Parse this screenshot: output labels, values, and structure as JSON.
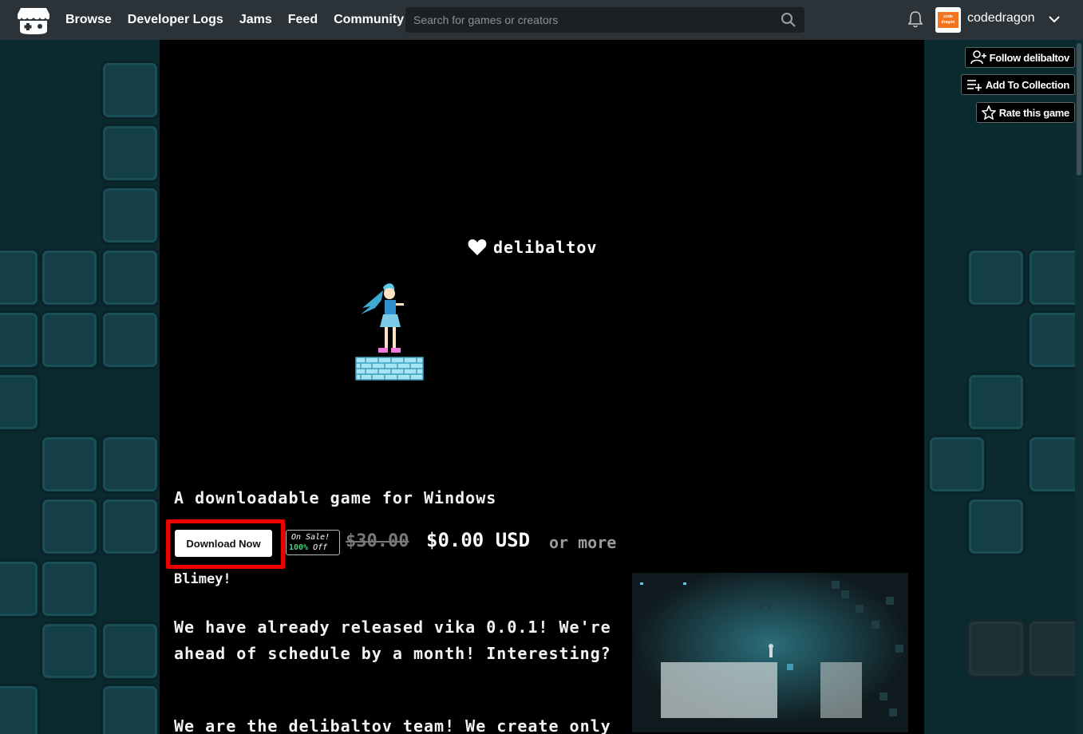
{
  "nav": {
    "items": [
      "Browse",
      "Developer Logs",
      "Jams",
      "Feed",
      "Community"
    ],
    "search_placeholder": "Search for games or creators",
    "username": "codedragon",
    "avatar_text": "code dragon"
  },
  "side_actions": {
    "follow": "Follow delibaltov",
    "collection": "Add To Collection",
    "rate": "Rate this game"
  },
  "game": {
    "header_name": "delibaltov",
    "tagline": "A downloadable game for Windows",
    "download_label": "Download Now",
    "sale_line1": "On Sale!",
    "sale_pct": "100%",
    "sale_off": "Off",
    "original_price": "$30.00",
    "price": "$0.00 USD",
    "or_more": "or more"
  },
  "description": {
    "heading": "Blimey!",
    "p1": "We have already released vika 0.0.1! We're ahead of schedule by a month! Interesting?",
    "p2": "We are the delibaltov team! We create only"
  },
  "colors": {
    "topbar": "#2b3338",
    "background": "#0b2a30",
    "column": "#000000",
    "highlight": "#ee0000",
    "sale_green": "#40d27a"
  }
}
